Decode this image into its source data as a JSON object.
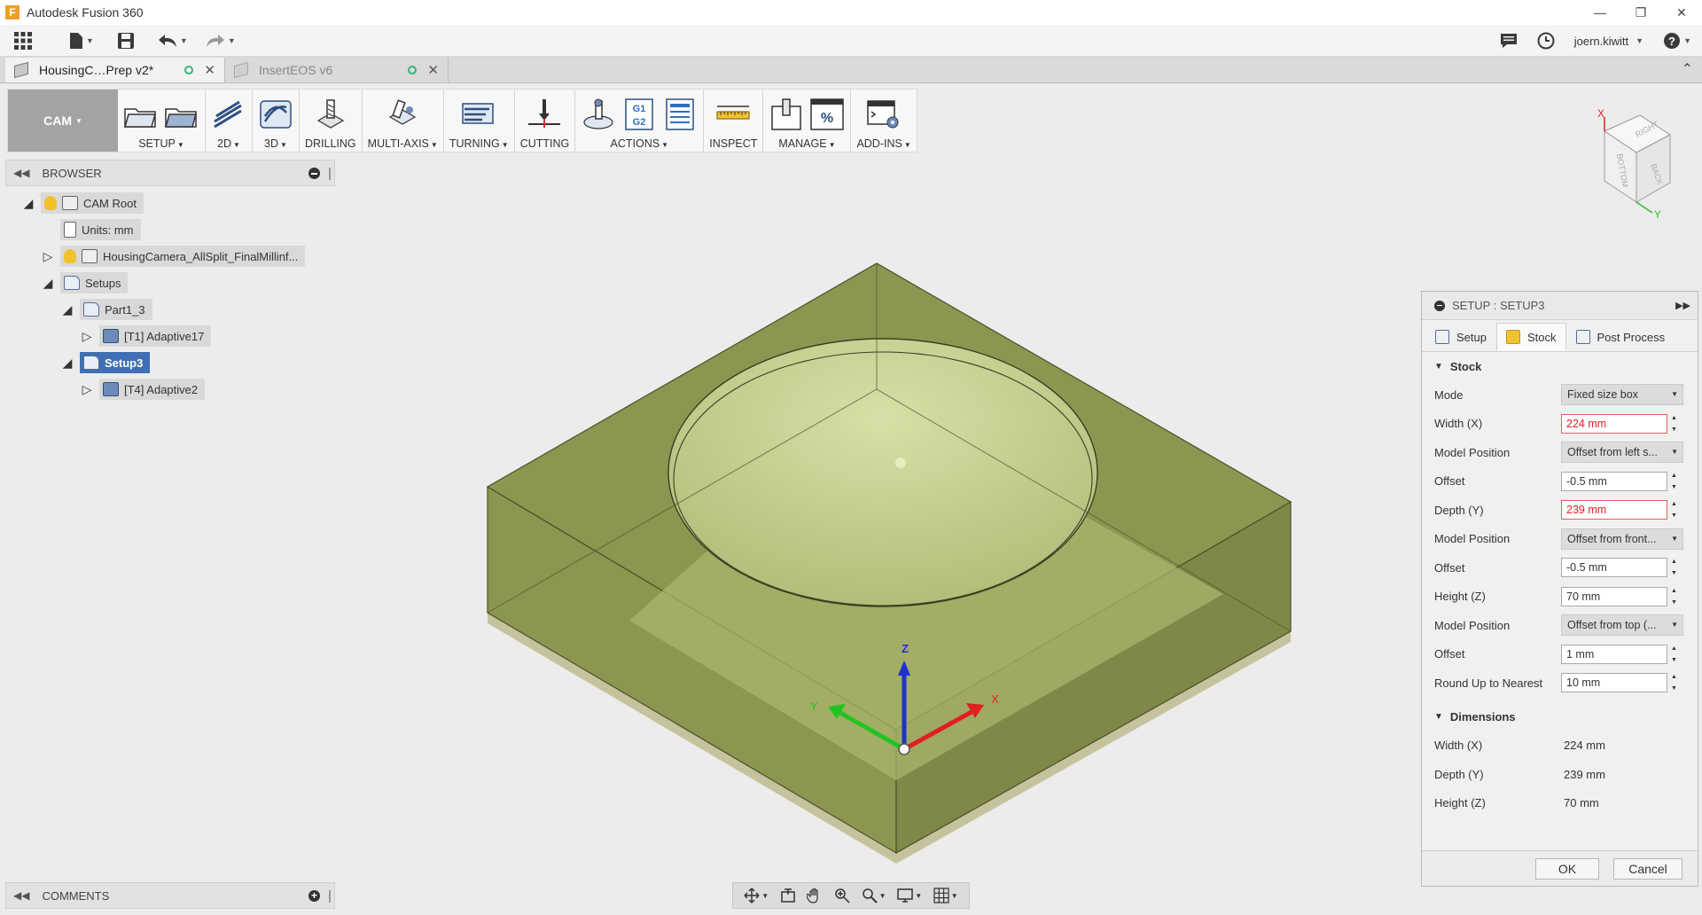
{
  "window": {
    "app_title": "Autodesk Fusion 360",
    "app_icon_letter": "F"
  },
  "quickbar": {
    "user": "joern.kiwitt"
  },
  "doc_tabs": [
    {
      "label": "HousingC…Prep v2*",
      "active": true
    },
    {
      "label": "InsertEOS v6",
      "active": false
    }
  ],
  "toolbar": {
    "workspace": "CAM",
    "groups": [
      {
        "label": "SETUP",
        "has_menu": true
      },
      {
        "label": "2D",
        "has_menu": true
      },
      {
        "label": "3D",
        "has_menu": true
      },
      {
        "label": "DRILLING",
        "has_menu": false
      },
      {
        "label": "MULTI-AXIS",
        "has_menu": true
      },
      {
        "label": "TURNING",
        "has_menu": true
      },
      {
        "label": "CUTTING",
        "has_menu": false
      },
      {
        "label": "ACTIONS",
        "has_menu": true,
        "g_code_label": "G1\nG2"
      },
      {
        "label": "INSPECT",
        "has_menu": false
      },
      {
        "label": "MANAGE",
        "has_menu": true,
        "percent_label": "%"
      },
      {
        "label": "ADD-INS",
        "has_menu": true
      }
    ]
  },
  "browser": {
    "title": "BROWSER",
    "items": [
      {
        "label": "CAM Root",
        "level": 0,
        "expanded": true
      },
      {
        "label": "Units: mm",
        "level": 1
      },
      {
        "label": "HousingCamera_AllSplit_FinalMillinf...",
        "level": 1,
        "expanded": false
      },
      {
        "label": "Setups",
        "level": 1,
        "expanded": true
      },
      {
        "label": "Part1_3",
        "level": 2,
        "expanded": true
      },
      {
        "label": "[T1] Adaptive17",
        "level": 3,
        "expanded": false
      },
      {
        "label": "Setup3",
        "level": 2,
        "expanded": true,
        "selected": true
      },
      {
        "label": "[T4] Adaptive2",
        "level": 3,
        "expanded": false
      }
    ]
  },
  "comments": {
    "title": "COMMENTS"
  },
  "viewcube": {
    "faces": [
      "RIGHT",
      "BOTTOM",
      "BACK"
    ],
    "axis_x": "X",
    "axis_y": "Y"
  },
  "triad": {
    "z": "Z",
    "x": "X",
    "y": "Y"
  },
  "setup_dialog": {
    "title": "SETUP : SETUP3",
    "tabs": [
      "Setup",
      "Stock",
      "Post Process"
    ],
    "active_tab": "Stock",
    "stock_section": "Stock",
    "stock_fields": [
      {
        "label": "Mode",
        "type": "select",
        "value": "Fixed size box"
      },
      {
        "label": "Width (X)",
        "type": "input",
        "value": "224 mm",
        "invalid": true
      },
      {
        "label": "Model Position",
        "type": "select",
        "value": "Offset from left s..."
      },
      {
        "label": "Offset",
        "type": "input",
        "value": "-0.5 mm"
      },
      {
        "label": "Depth (Y)",
        "type": "input",
        "value": "239 mm",
        "invalid": true
      },
      {
        "label": "Model Position",
        "type": "select",
        "value": "Offset from front..."
      },
      {
        "label": "Offset",
        "type": "input",
        "value": "-0.5 mm"
      },
      {
        "label": "Height (Z)",
        "type": "input",
        "value": "70 mm"
      },
      {
        "label": "Model Position",
        "type": "select",
        "value": "Offset from top (..."
      },
      {
        "label": "Offset",
        "type": "input",
        "value": "1 mm"
      },
      {
        "label": "Round Up to Nearest",
        "type": "input",
        "value": "10 mm"
      }
    ],
    "dimensions_section": "Dimensions",
    "dimensions": [
      {
        "label": "Width (X)",
        "value": "224 mm"
      },
      {
        "label": "Depth (Y)",
        "value": "239 mm"
      },
      {
        "label": "Height (Z)",
        "value": "70 mm"
      }
    ],
    "ok_label": "OK",
    "cancel_label": "Cancel"
  },
  "colors": {
    "stock_fill": "#8c9650",
    "stock_top": "#a9b56a",
    "selection": "#3f6fb5",
    "invalid": "#e02020"
  }
}
